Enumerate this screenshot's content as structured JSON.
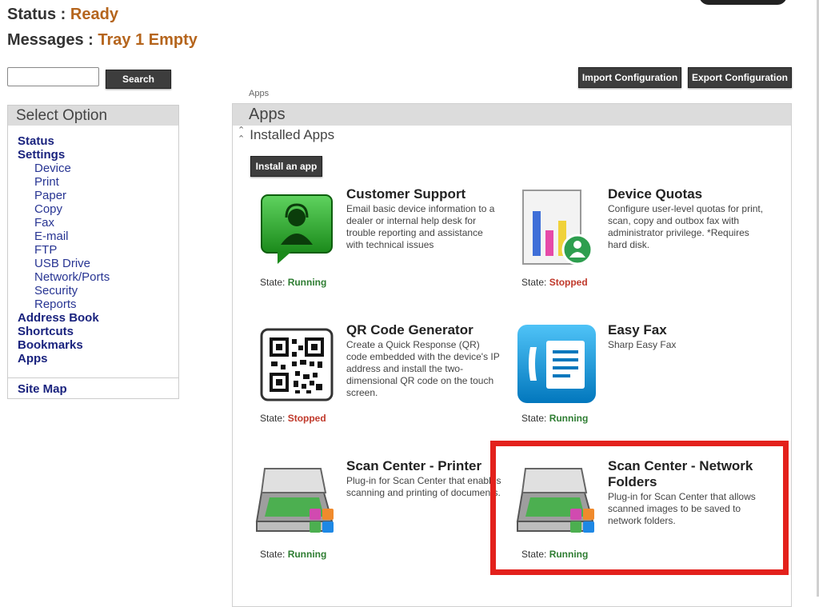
{
  "header": {
    "status_label": "Status : ",
    "status_value": "Ready",
    "messages_label": "Messages : ",
    "messages_value": "Tray 1 Empty"
  },
  "search": {
    "placeholder": "",
    "button": "Search"
  },
  "toolbar": {
    "import": "Import Configuration",
    "export": "Export Configuration"
  },
  "breadcrumb": "Apps",
  "sidebar": {
    "title": "Select Option",
    "top": [
      "Status",
      "Settings"
    ],
    "settings_items": [
      "Device",
      "Print",
      "Paper",
      "Copy",
      "Fax",
      "E-mail",
      "FTP",
      "USB Drive",
      "Network/Ports",
      "Security",
      "Reports"
    ],
    "bottom": [
      "Address Book",
      "Shortcuts",
      "Bookmarks",
      "Apps"
    ],
    "site_map": "Site Map"
  },
  "main": {
    "title": "Apps",
    "section": "Installed Apps",
    "install_button": "Install an app",
    "state_label": "State: ",
    "apps": [
      {
        "title": "Customer Support",
        "desc": "Email basic device information to a dealer or internal help desk for trouble reporting and assistance with technical issues",
        "state": "Running",
        "icon": "support-icon"
      },
      {
        "title": "Device Quotas",
        "desc": "Configure user-level quotas for print, scan, copy and outbox fax with administrator privilege. *Requires hard disk.",
        "state": "Stopped",
        "icon": "quota-chart-icon"
      },
      {
        "title": "QR Code Generator",
        "desc": "Create a Quick Response (QR) code embedded with the device's IP address and install the two-dimensional QR code on the touch screen.",
        "state": "Stopped",
        "icon": "qr-code-icon"
      },
      {
        "title": "Easy Fax",
        "desc": "Sharp Easy Fax",
        "state": "Running",
        "icon": "fax-icon"
      },
      {
        "title": "Scan Center - Printer",
        "desc": "Plug-in for Scan Center that enables scanning and printing of documents.",
        "state": "Running",
        "icon": "scanner-icon"
      },
      {
        "title": "Scan Center - Network Folders",
        "desc": "Plug-in for Scan Center that allows scanned images to be saved to network folders.",
        "state": "Running",
        "icon": "scanner-icon"
      }
    ]
  },
  "colors": {
    "running": "#2e7d32",
    "stopped": "#c0392b",
    "highlight": "#e3211c",
    "status_value": "#b5651d"
  }
}
